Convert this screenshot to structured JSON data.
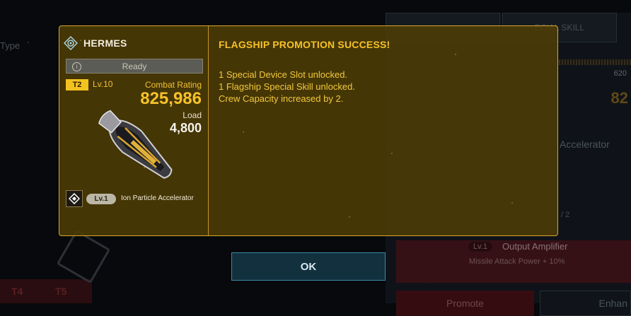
{
  "background": {
    "type_label": "Type",
    "tab_special_skill": "ECIAL SKILL",
    "rating_partial": "620",
    "combat_partial": "82",
    "accelerator_label": "Accelerator",
    "slot_count": "/ 2",
    "output_amplifier": {
      "level": "Lv.1",
      "name": "Output Amplifier",
      "effect": "Missile Attack Power + 10%"
    },
    "promote_button": "Promote",
    "enhance_button": "Enhan",
    "tiers": [
      "T4",
      "T5"
    ]
  },
  "ship_card": {
    "name": "HERMES",
    "status": "Ready",
    "tier": "T2",
    "level": "Lv.10",
    "combat_rating_label": "Combat Rating",
    "combat_rating": "825,986",
    "load_label": "Load",
    "load": "4,800",
    "device": {
      "level": "Lv.1",
      "name": "Ion Particle Accelerator"
    }
  },
  "message": {
    "title": "FLAGSHIP PROMOTION SUCCESS!",
    "lines": [
      "1 Special Device Slot unlocked.",
      "1 Flagship Special Skill unlocked.",
      "Crew Capacity increased by 2."
    ]
  },
  "ok_button": "OK",
  "colors": {
    "accent": "#f6c229",
    "dialog_border": "#d9a62a",
    "button_border": "#3b88a8"
  }
}
